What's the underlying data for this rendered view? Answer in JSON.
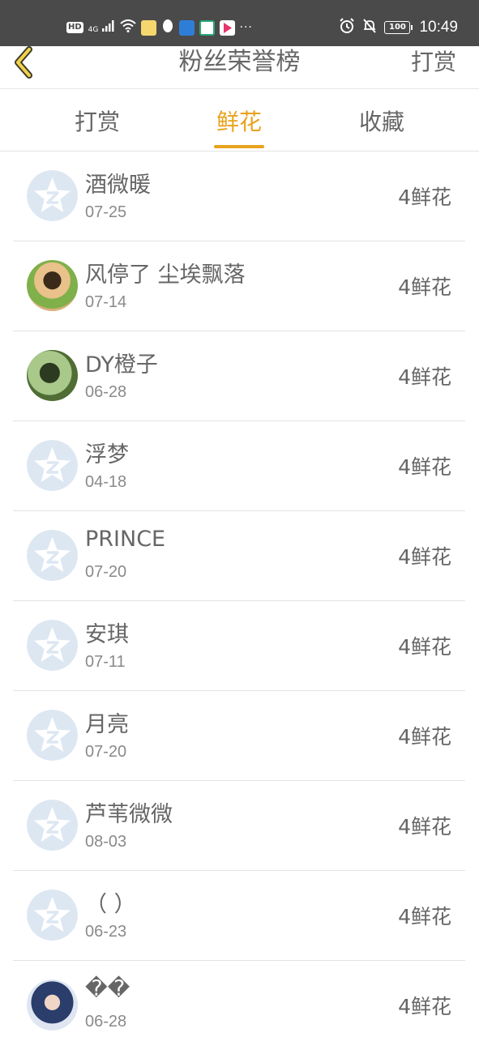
{
  "status_bar": {
    "left_badge": "HD",
    "signal_text": "4G",
    "dots": "···",
    "battery": "100",
    "time": "10:49"
  },
  "header": {
    "title": "粉丝荣誉榜",
    "right_action": "打赏"
  },
  "tabs": [
    {
      "label": "打赏",
      "active": false
    },
    {
      "label": "鲜花",
      "active": true
    },
    {
      "label": "收藏",
      "active": false
    }
  ],
  "colors": {
    "accent": "#e9a21c",
    "status_bar_bg": "#4a4a4a",
    "text": "#666666",
    "date_text": "#8a8a8a",
    "default_avatar_bg": "#dde7f2"
  },
  "list": [
    {
      "name": "酒微暖",
      "date": "07-25",
      "count": "4鲜花",
      "avatar": "default-qzone-avatar"
    },
    {
      "name": "风停了 尘埃飘落",
      "date": "07-14",
      "count": "4鲜花",
      "avatar": "photo-avatar"
    },
    {
      "name": "DY橙子",
      "date": "06-28",
      "count": "4鲜花",
      "avatar": "photo-avatar"
    },
    {
      "name": "浮梦",
      "date": "04-18",
      "count": "4鲜花",
      "avatar": "default-qzone-avatar"
    },
    {
      "name": "PRINCE",
      "date": "07-20",
      "count": "4鲜花",
      "avatar": "default-qzone-avatar"
    },
    {
      "name": "安琪",
      "date": "07-11",
      "count": "4鲜花",
      "avatar": "default-qzone-avatar"
    },
    {
      "name": "月亮",
      "date": "07-20",
      "count": "4鲜花",
      "avatar": "default-qzone-avatar"
    },
    {
      "name": "芦苇微微",
      "date": "08-03",
      "count": "4鲜花",
      "avatar": "default-qzone-avatar"
    },
    {
      "name": "（ ）",
      "date": "06-23",
      "count": "4鲜花",
      "avatar": "default-qzone-avatar"
    },
    {
      "name": "��",
      "date": "06-28",
      "count": "4鲜花",
      "avatar": "photo-avatar"
    }
  ]
}
